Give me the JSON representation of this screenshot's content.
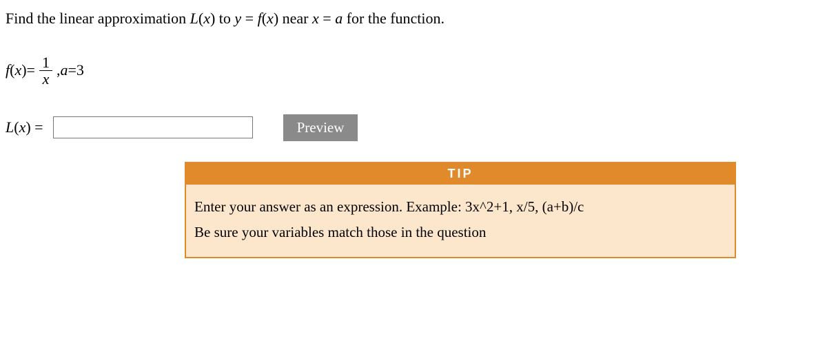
{
  "problem": {
    "pre": "Find the linear approximation ",
    "mid1": " to ",
    "mid2": " near ",
    "post": " for the function."
  },
  "lin_label_L": "L",
  "lin_label_x": "x",
  "eq_f_label": "f",
  "eq_y": "y",
  "eq_eq": " = ",
  "eq_a": "a",
  "fn": {
    "lhs_f": "f",
    "lhs_x": "x",
    "num": "1",
    "den": "x",
    "sep": " , ",
    "a_lhs": "a",
    "a_rhs": "3"
  },
  "answer": {
    "label_L": "L",
    "label_x": "x",
    "input_value": "",
    "preview_label": "Preview"
  },
  "tip": {
    "header": "TIP",
    "line1": "Enter your answer as an expression. Example: 3x^2+1, x/5, (a+b)/c",
    "line2": "Be sure your variables match those in the question"
  }
}
